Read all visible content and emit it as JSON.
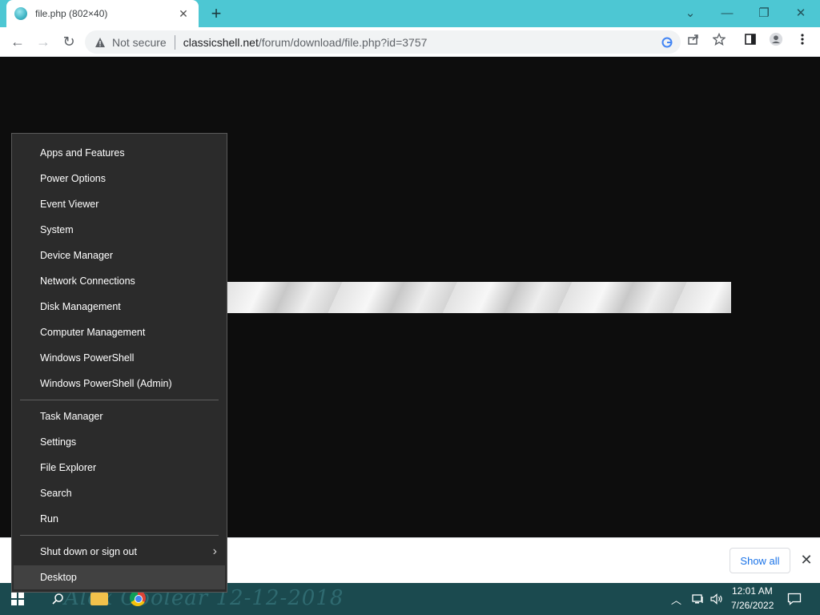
{
  "browser": {
    "tab_title": "file.php (802×40)",
    "tab_close": "✕",
    "new_tab": "+",
    "window_controls": {
      "dropdown": "⌄",
      "minimize": "—",
      "restore": "❐",
      "close": "✕"
    },
    "nav": {
      "back": "←",
      "forward": "→",
      "reload": "↻"
    },
    "security_label": "Not secure",
    "url_host": "classicshell.net",
    "url_path": "/forum/download/file.php?id=3757",
    "icons": [
      "google-icon",
      "share-icon",
      "star-icon",
      "sidepanel-icon",
      "profile-icon",
      "menu-icon"
    ]
  },
  "download_bar": {
    "show_all_label": "Show all",
    "close": "✕"
  },
  "winx_menu": {
    "group1": [
      "Apps and Features",
      "Power Options",
      "Event Viewer",
      "System",
      "Device Manager",
      "Network Connections",
      "Disk Management",
      "Computer Management",
      "Windows PowerShell",
      "Windows PowerShell (Admin)"
    ],
    "group2": [
      "Task Manager",
      "Settings",
      "File Explorer",
      "Search",
      "Run"
    ],
    "group3": [
      "Shut down or sign out",
      "Desktop"
    ],
    "submenu_arrow": "›"
  },
  "taskbar": {
    "watermark": "Alex Coolear 12-12-2018",
    "time": "12:01 AM",
    "date": "7/26/2022",
    "tray_chevron": "︿"
  },
  "colors": {
    "tab_strip": "#4dc7d3",
    "menu_bg": "#2b2b2b",
    "taskbar": "#1b4a4f",
    "link_blue": "#1a73e8"
  }
}
